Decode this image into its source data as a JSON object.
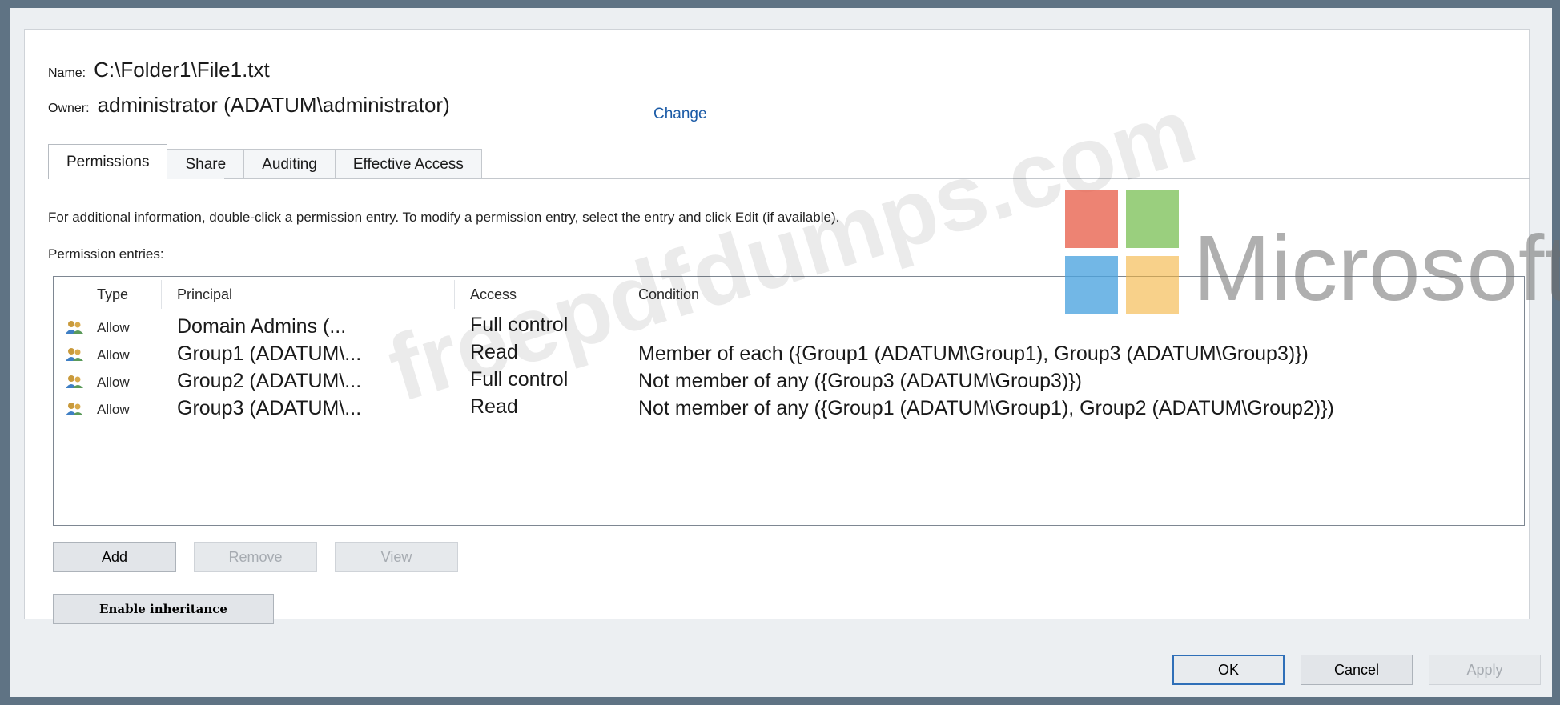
{
  "header": {
    "name_label": "Name:",
    "name_value": "C:\\Folder1\\File1.txt",
    "owner_label": "Owner:",
    "owner_value": "administrator (ADATUM\\administrator)",
    "change_link": "Change"
  },
  "tabs": [
    {
      "label": "Permissions",
      "active": true
    },
    {
      "label": "Share",
      "active": false
    },
    {
      "label": "Auditing",
      "active": false
    },
    {
      "label": "Effective Access",
      "active": false
    }
  ],
  "info_text": "For additional information, double-click a permission entry. To modify a permission entry, select the entry and click Edit (if available).",
  "entries_label": "Permission entries:",
  "list": {
    "columns": [
      "Type",
      "Principal",
      "Access",
      "Condition"
    ],
    "rows": [
      {
        "type": "Allow",
        "principal": "Domain Admins (...",
        "access": "Full control",
        "condition": ""
      },
      {
        "type": "Allow",
        "principal": "Group1 (ADATUM\\...",
        "access": "Read",
        "condition": "Member of each ({Group1 (ADATUM\\Group1), Group3 (ADATUM\\Group3)})"
      },
      {
        "type": "Allow",
        "principal": "Group2 (ADATUM\\...",
        "access": "Full control",
        "condition": "Not member of any ({Group3 (ADATUM\\Group3)})"
      },
      {
        "type": "Allow",
        "principal": "Group3 (ADATUM\\...",
        "access": "Read",
        "condition": "Not member of any ({Group1 (ADATUM\\Group1), Group2 (ADATUM\\Group2)})"
      }
    ]
  },
  "buttons": {
    "add": "Add",
    "remove": "Remove",
    "view": "View",
    "enable_inheritance": "Enable inheritance",
    "ok": "OK",
    "cancel": "Cancel",
    "apply": "Apply"
  },
  "watermark": {
    "text": "freepdfdumps.com",
    "brand": "Microsoft"
  },
  "colors": {
    "link": "#1a5aa6",
    "ms_red": "#e8604c",
    "ms_green": "#7dc15a",
    "ms_blue": "#4aa3df",
    "ms_yellow": "#f3b23c"
  }
}
